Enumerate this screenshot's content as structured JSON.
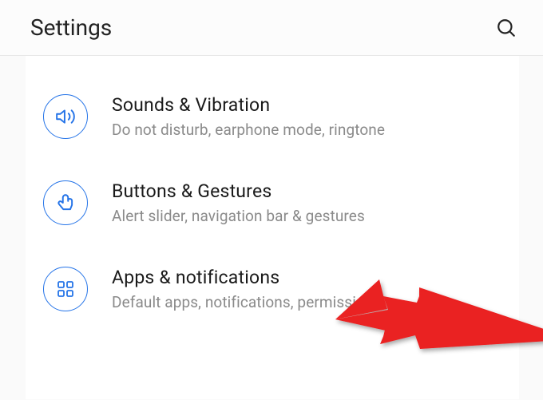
{
  "header": {
    "title": "Settings"
  },
  "items": [
    {
      "icon": "sound-icon",
      "title": "Sounds & Vibration",
      "subtitle": "Do not disturb, earphone mode, ringtone"
    },
    {
      "icon": "gesture-icon",
      "title": "Buttons & Gestures",
      "subtitle": "Alert slider, navigation bar & gestures"
    },
    {
      "icon": "apps-icon",
      "title": "Apps & notifications",
      "subtitle": "Default apps, notifications, permissions"
    }
  ],
  "colors": {
    "accent": "#2574e8",
    "annotation": "#ea2020"
  }
}
